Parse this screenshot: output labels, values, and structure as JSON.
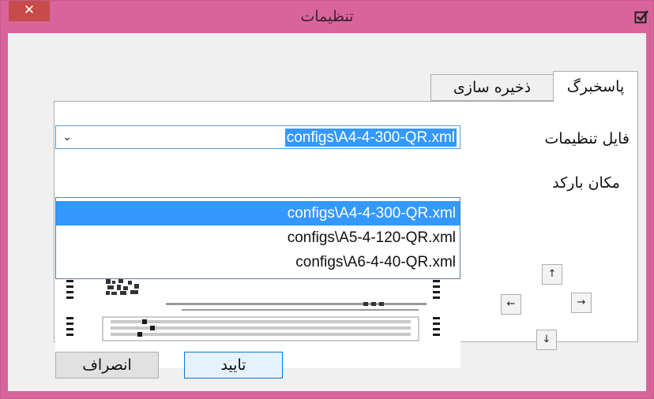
{
  "window": {
    "title": "تنظیمات",
    "close_glyph": "✕",
    "system_icon": "checkbox-icon"
  },
  "tabs": [
    {
      "label": "پاسخبرگ",
      "active": true
    },
    {
      "label": "ذخیره سازی",
      "active": false
    }
  ],
  "settings": {
    "config_label": "فایل تنظیمات",
    "barcode_label": "مکان بارکد",
    "config_selected": "configs\\A4-4-300-QR.xml",
    "config_options": [
      "configs\\A4-4-300-QR.xml",
      "configs\\A5-4-120-QR.xml",
      "configs\\A6-4-40-QR.xml"
    ]
  },
  "arrows": {
    "up": "↑",
    "left": "←",
    "right": "→",
    "down": "↓"
  },
  "buttons": {
    "ok": "تایید",
    "cancel": "انصراف"
  },
  "colors": {
    "titlebar": "#d9649c",
    "close": "#c74b4b",
    "selection": "#3399ff",
    "focus_border": "#0078d7"
  }
}
